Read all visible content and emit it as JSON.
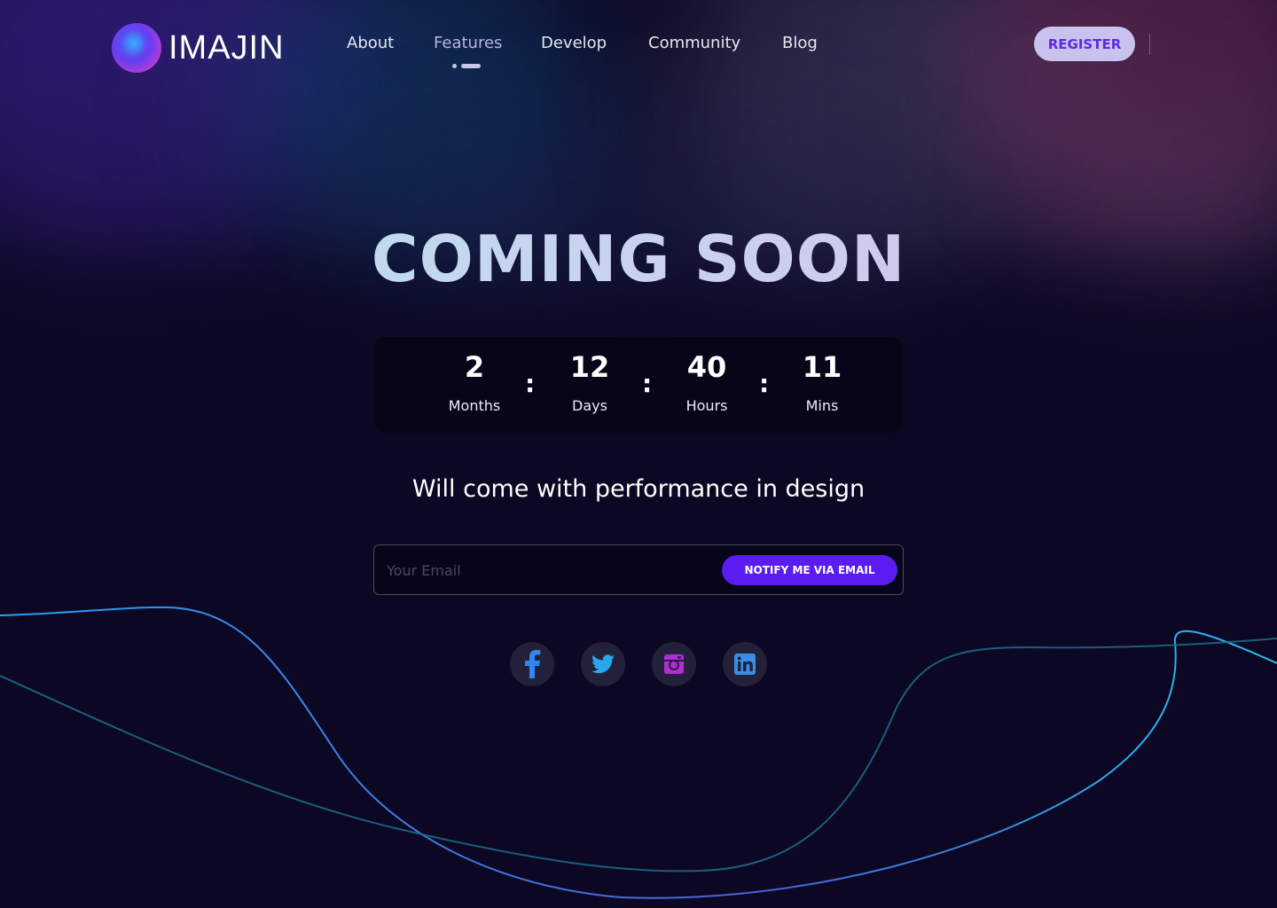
{
  "brand": {
    "name": "IMAJIN"
  },
  "nav": {
    "items": [
      {
        "label": "About",
        "active": false
      },
      {
        "label": "Features",
        "active": true
      },
      {
        "label": "Develop",
        "active": false
      },
      {
        "label": "Community",
        "active": false
      },
      {
        "label": "Blog",
        "active": false
      }
    ]
  },
  "header": {
    "register_label": "REGISTER"
  },
  "hero": {
    "headline": "COMING SOON",
    "tagline": "Will come with performance in design"
  },
  "countdown": {
    "separator": ":",
    "units": [
      {
        "value": "2",
        "label": "Months"
      },
      {
        "value": "12",
        "label": "Days"
      },
      {
        "value": "40",
        "label": "Hours"
      },
      {
        "value": "11",
        "label": "Mins"
      }
    ]
  },
  "signup": {
    "placeholder": "Your Email",
    "button_label": "NOTIFY ME VIA EMAIL"
  },
  "social": [
    {
      "icon": "facebook-icon",
      "color": "#2f86f6"
    },
    {
      "icon": "twitter-icon",
      "color": "#2aa8ee"
    },
    {
      "icon": "instagram-icon",
      "color": "#b12bd6"
    },
    {
      "icon": "linkedin-icon",
      "color": "#3a8ee6"
    }
  ],
  "colors": {
    "background": "#0c0823",
    "accent": "#5a1cf0",
    "register_bg": "#c9c2ef",
    "register_text": "#5b2be0"
  }
}
